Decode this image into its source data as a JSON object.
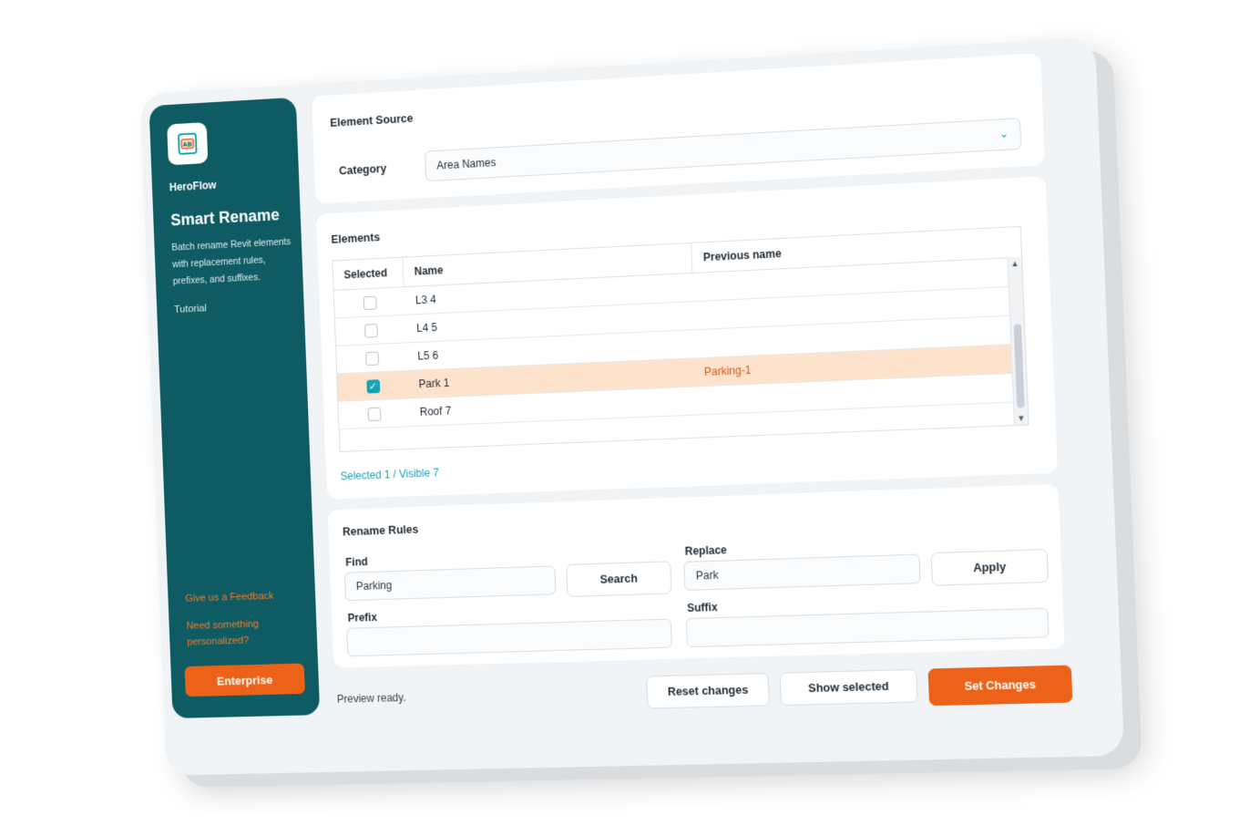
{
  "sidebar": {
    "brand": "HeroFlow",
    "logo_text": "AB",
    "title": "Smart Rename",
    "description": "Batch rename Revit elements with replacement rules, prefixes, and suffixes.",
    "tutorial": "Tutorial",
    "feedback": "Give us a Feedback",
    "personalized": "Need something personalized?",
    "enterprise": "Enterprise"
  },
  "source": {
    "title": "Element Source",
    "category_label": "Category",
    "category_value": "Area Names"
  },
  "elements": {
    "title": "Elements",
    "columns": [
      "Selected",
      "Name",
      "Previous name"
    ],
    "rows": [
      {
        "selected": false,
        "name": "L3 4",
        "previous": ""
      },
      {
        "selected": false,
        "name": "L4 5",
        "previous": ""
      },
      {
        "selected": false,
        "name": "L5 6",
        "previous": ""
      },
      {
        "selected": true,
        "name": "Park 1",
        "previous": "Parking-1"
      },
      {
        "selected": false,
        "name": "Roof 7",
        "previous": ""
      }
    ],
    "status": "Selected 1 / Visible 7"
  },
  "rules": {
    "title": "Rename Rules",
    "find_label": "Find",
    "find_value": "Parking",
    "search_button": "Search",
    "replace_label": "Replace",
    "replace_value": "Park",
    "apply_button": "Apply",
    "prefix_label": "Prefix",
    "prefix_value": "",
    "suffix_label": "Suffix",
    "suffix_value": ""
  },
  "footer": {
    "status": "Preview ready.",
    "reset": "Reset changes",
    "show_selected": "Show selected",
    "set_changes": "Set Changes"
  },
  "colors": {
    "sidebar": "#0e5b63",
    "accent_orange": "#ec6218",
    "accent_teal": "#17a3b5",
    "highlight_row": "#fde3cc"
  }
}
